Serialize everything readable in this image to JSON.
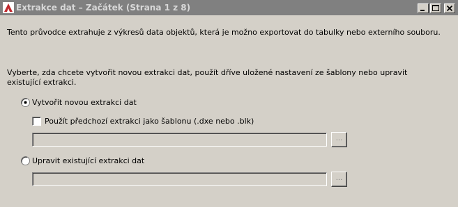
{
  "window": {
    "title": "Extrakce dat – Začátek (Strana 1 z 8)",
    "controls": [
      "minimize-icon",
      "maximize-icon",
      "close-icon"
    ]
  },
  "intro_text": "Tento průvodce extrahuje z výkresů data objektů, která je možno exportovat do tabulky nebo externího souboru.",
  "prompt_text": "Vyberte, zda chcete vytvořit novou extrakci dat, použít dříve uložené nastavení ze šablony nebo upravit existující extrakci.",
  "options": {
    "new_extraction": {
      "label": "Vytvořit novou extrakci dat",
      "selected": true
    },
    "use_template": {
      "label": "Použít předchozí extrakci jako šablonu (.dxe nebo .blk)",
      "checked": false,
      "enabled": true
    },
    "template_path": {
      "value": "",
      "enabled": false
    },
    "edit_existing": {
      "label": "Upravit existující extrakci dat",
      "selected": false
    },
    "existing_path": {
      "value": "",
      "enabled": false
    }
  },
  "browse_label": "...",
  "colors": {
    "face": "#d4d0c8",
    "titlebar_inactive": "#808080",
    "icon_red": "#c0282d"
  }
}
